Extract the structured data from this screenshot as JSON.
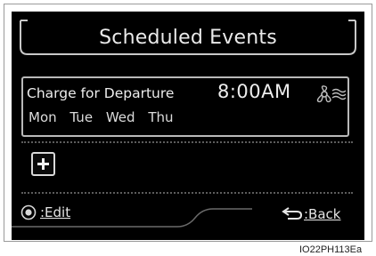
{
  "screen": {
    "title": "Scheduled Events"
  },
  "event": {
    "name": "Charge for Departure",
    "time": "8:00AM",
    "days": [
      "Mon",
      "Tue",
      "Wed",
      "Thu"
    ],
    "icon": "climate-fan-icon"
  },
  "add_button": {
    "icon": "plus-icon"
  },
  "footer": {
    "edit_icon": "knob-icon",
    "edit_label": ":Edit",
    "back_icon": "back-arrow-icon",
    "back_label": ":Back"
  },
  "image_code": "IO22PH113Ea",
  "colors": {
    "screen_bg": "#000000",
    "text": "#ededed",
    "border": "#b9b9b9"
  }
}
